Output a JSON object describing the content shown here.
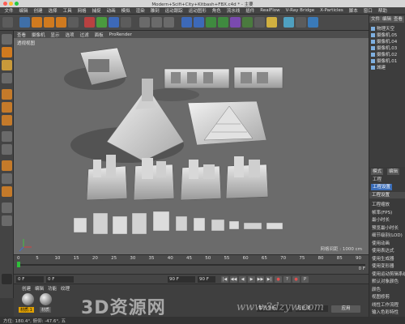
{
  "window": {
    "title": "Modern+Scifi+City+Kitbash+FBX.c4d * - 主要"
  },
  "menu": [
    "文件",
    "编辑",
    "创建",
    "选择",
    "工具",
    "网格",
    "捕捉",
    "动画",
    "模拟",
    "渲染",
    "雕刻",
    "运动跟踪",
    "运动图形",
    "角色",
    "流水线",
    "插件",
    "RealFlow",
    "V-Ray Bridge",
    "X-Particles",
    "脚本",
    "窗口",
    "帮助"
  ],
  "viewport": {
    "menu": [
      "查看",
      "摄像机",
      "显示",
      "选项",
      "过滤",
      "面板",
      "ProRender"
    ],
    "label": "透视视图",
    "grid_spacing": "网格间距 : 1000 cm"
  },
  "timeline": {
    "ticks": [
      "0",
      "5",
      "10",
      "15",
      "20",
      "25",
      "30",
      "35",
      "40",
      "45",
      "50",
      "55",
      "60",
      "65",
      "70",
      "75",
      "80",
      "85",
      "90"
    ],
    "current_frame": "0 F"
  },
  "transport": {
    "start": "0 F",
    "current": "0 F",
    "end": "90 F",
    "end2": "90 F",
    "buttons": [
      "|◀",
      "◀◀",
      "◀",
      "▶",
      "▶▶",
      "▶|",
      "●",
      "?",
      "●",
      "P"
    ]
  },
  "materials": {
    "menu": [
      "创建",
      "编辑",
      "功能",
      "纹理"
    ],
    "items": [
      {
        "name": "材质.1"
      },
      {
        "name": "材质"
      }
    ],
    "coord_fields": [
      "世界坐标",
      "按比例",
      "应用"
    ]
  },
  "objects": {
    "tabs": [
      "文件",
      "编辑",
      "查看"
    ],
    "items": [
      "物理天空",
      "摄像机.05",
      "摄像机.04",
      "摄像机.03",
      "摄像机.02",
      "摄像机.01",
      "城建"
    ]
  },
  "attributes": {
    "tabs": [
      "模式",
      "编辑"
    ],
    "subtabs": [
      "工程",
      "工程设置"
    ],
    "header": "工程设置",
    "rows": [
      "工程缩放",
      "帧率(FPS)",
      "最小时长",
      "预览最小时长",
      "细节级别(LOD)",
      "使用动画",
      "使用表达式",
      "使用生成器",
      "使用变形器",
      "使用运动剪辑系统",
      "默认对象颜色",
      "颜色",
      "视图修剪",
      "线性工作流程",
      "输入色彩特性"
    ]
  },
  "status": "方位: 180.4°, 俯仰: -47.6°, 五",
  "watermark": {
    "main": "3D资源网",
    "url": "www.3dzyw.com"
  },
  "colors": {
    "accent": "#2fbf3a",
    "material_tag": "#e0a000",
    "viewport_bg": "#6b6b6b"
  }
}
